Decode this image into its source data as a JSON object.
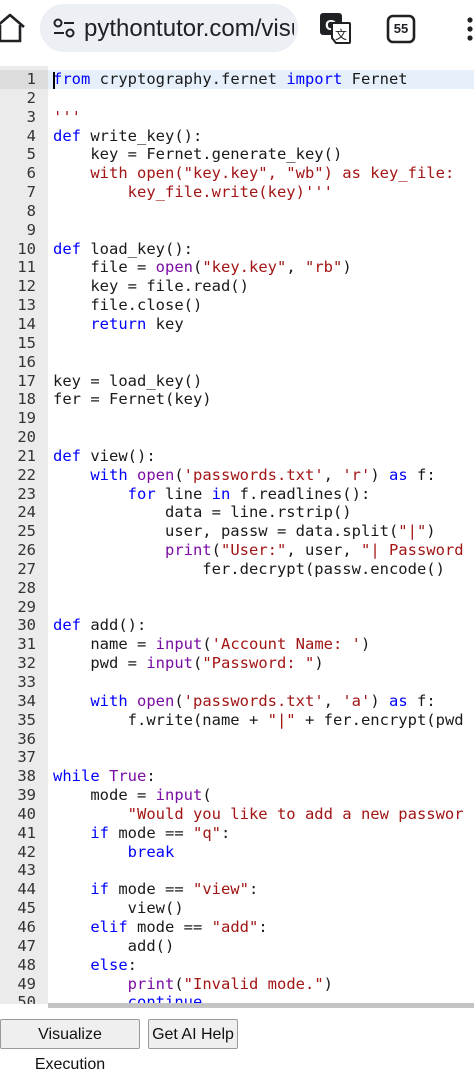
{
  "browser": {
    "url": "pythontutor.com/visua",
    "tab_count": "55"
  },
  "editor": {
    "lines": [
      [
        {
          "t": "from ",
          "c": "kw"
        },
        {
          "t": "cryptography.fernet "
        },
        {
          "t": "import ",
          "c": "kw"
        },
        {
          "t": "Fernet"
        }
      ],
      [],
      [
        {
          "t": "'''",
          "c": "str"
        }
      ],
      [
        {
          "t": "def ",
          "c": "kw"
        },
        {
          "t": "write_key():"
        }
      ],
      [
        {
          "t": "    key = Fernet.generate_key()"
        }
      ],
      [
        {
          "t": "    with open(",
          "c": "str"
        },
        {
          "t": "\"key.key\", \"wb\"",
          "c": "str"
        },
        {
          "t": ") as key_file:",
          "c": "str"
        }
      ],
      [
        {
          "t": "        key_file.write(key)'''",
          "c": "str"
        }
      ],
      [],
      [],
      [
        {
          "t": "def ",
          "c": "kw"
        },
        {
          "t": "load_key():"
        }
      ],
      [
        {
          "t": "    file = "
        },
        {
          "t": "open",
          "c": "bi"
        },
        {
          "t": "("
        },
        {
          "t": "\"key.key\"",
          "c": "str"
        },
        {
          "t": ", "
        },
        {
          "t": "\"rb\"",
          "c": "str"
        },
        {
          "t": ")"
        }
      ],
      [
        {
          "t": "    key = file.read()"
        }
      ],
      [
        {
          "t": "    file.close()"
        }
      ],
      [
        {
          "t": "    "
        },
        {
          "t": "return ",
          "c": "kw"
        },
        {
          "t": "key"
        }
      ],
      [],
      [],
      [
        {
          "t": "key = load_key()"
        }
      ],
      [
        {
          "t": "fer = Fernet(key)"
        }
      ],
      [],
      [],
      [
        {
          "t": "def ",
          "c": "kw"
        },
        {
          "t": "view():"
        }
      ],
      [
        {
          "t": "    "
        },
        {
          "t": "with ",
          "c": "kw"
        },
        {
          "t": "open",
          "c": "bi"
        },
        {
          "t": "("
        },
        {
          "t": "'passwords.txt'",
          "c": "str"
        },
        {
          "t": ", "
        },
        {
          "t": "'r'",
          "c": "str"
        },
        {
          "t": ") "
        },
        {
          "t": "as ",
          "c": "kw"
        },
        {
          "t": "f:"
        }
      ],
      [
        {
          "t": "        "
        },
        {
          "t": "for ",
          "c": "kw"
        },
        {
          "t": "line "
        },
        {
          "t": "in ",
          "c": "kw"
        },
        {
          "t": "f.readlines():"
        }
      ],
      [
        {
          "t": "            data = line.rstrip()"
        }
      ],
      [
        {
          "t": "            user, passw = data.split("
        },
        {
          "t": "\"|\"",
          "c": "str"
        },
        {
          "t": ")"
        }
      ],
      [
        {
          "t": "            "
        },
        {
          "t": "print",
          "c": "bi"
        },
        {
          "t": "("
        },
        {
          "t": "\"User:\"",
          "c": "str"
        },
        {
          "t": ", user, "
        },
        {
          "t": "\"| Password",
          "c": "str"
        }
      ],
      [
        {
          "t": "                fer.decrypt(passw.encode()"
        }
      ],
      [],
      [],
      [
        {
          "t": "def ",
          "c": "kw"
        },
        {
          "t": "add():"
        }
      ],
      [
        {
          "t": "    name = "
        },
        {
          "t": "input",
          "c": "bi"
        },
        {
          "t": "("
        },
        {
          "t": "'Account Name: '",
          "c": "str"
        },
        {
          "t": ")"
        }
      ],
      [
        {
          "t": "    pwd = "
        },
        {
          "t": "input",
          "c": "bi"
        },
        {
          "t": "("
        },
        {
          "t": "\"Password: \"",
          "c": "str"
        },
        {
          "t": ")"
        }
      ],
      [],
      [
        {
          "t": "    "
        },
        {
          "t": "with ",
          "c": "kw"
        },
        {
          "t": "open",
          "c": "bi"
        },
        {
          "t": "("
        },
        {
          "t": "'passwords.txt'",
          "c": "str"
        },
        {
          "t": ", "
        },
        {
          "t": "'a'",
          "c": "str"
        },
        {
          "t": ") "
        },
        {
          "t": "as ",
          "c": "kw"
        },
        {
          "t": "f:"
        }
      ],
      [
        {
          "t": "        f.write(name + "
        },
        {
          "t": "\"|\"",
          "c": "str"
        },
        {
          "t": " + fer.encrypt(pwd"
        }
      ],
      [],
      [],
      [
        {
          "t": "while ",
          "c": "kw"
        },
        {
          "t": "True",
          "c": "bi"
        },
        {
          "t": ":"
        }
      ],
      [
        {
          "t": "    mode = "
        },
        {
          "t": "input",
          "c": "bi"
        },
        {
          "t": "("
        }
      ],
      [
        {
          "t": "        "
        },
        {
          "t": "\"Would you like to add a new passwor",
          "c": "str"
        }
      ],
      [
        {
          "t": "    "
        },
        {
          "t": "if ",
          "c": "kw"
        },
        {
          "t": "mode == "
        },
        {
          "t": "\"q\"",
          "c": "str"
        },
        {
          "t": ":"
        }
      ],
      [
        {
          "t": "        "
        },
        {
          "t": "break",
          "c": "kw"
        }
      ],
      [],
      [
        {
          "t": "    "
        },
        {
          "t": "if ",
          "c": "kw"
        },
        {
          "t": "mode == "
        },
        {
          "t": "\"view\"",
          "c": "str"
        },
        {
          "t": ":"
        }
      ],
      [
        {
          "t": "        view()"
        }
      ],
      [
        {
          "t": "    "
        },
        {
          "t": "elif ",
          "c": "kw"
        },
        {
          "t": "mode == "
        },
        {
          "t": "\"add\"",
          "c": "str"
        },
        {
          "t": ":"
        }
      ],
      [
        {
          "t": "        add()"
        }
      ],
      [
        {
          "t": "    "
        },
        {
          "t": "else",
          "c": "kw"
        },
        {
          "t": ":"
        }
      ],
      [
        {
          "t": "        "
        },
        {
          "t": "print",
          "c": "bi"
        },
        {
          "t": "("
        },
        {
          "t": "\"Invalid mode.\"",
          "c": "str"
        },
        {
          "t": ")"
        }
      ],
      [
        {
          "t": "        "
        },
        {
          "t": "continue",
          "c": "kw"
        }
      ]
    ]
  },
  "buttons": {
    "visualize": "Visualize Execution",
    "ai_help": "Get AI Help"
  }
}
